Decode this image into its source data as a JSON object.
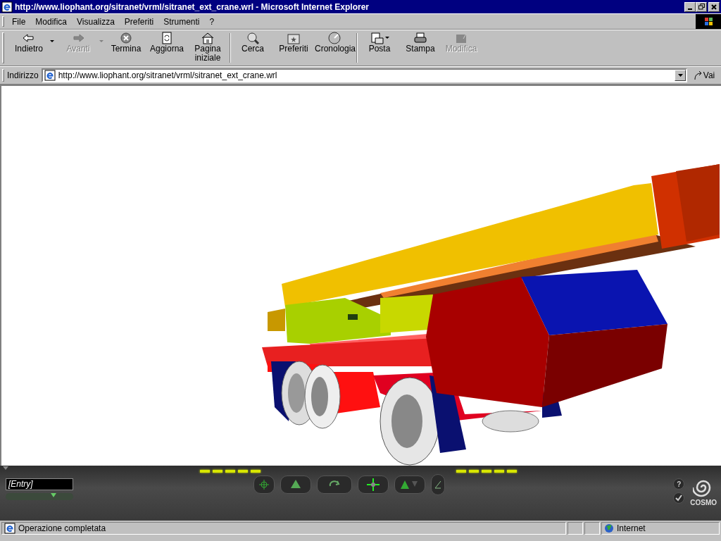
{
  "window": {
    "title": "http://www.liophant.org/sitranet/vrml/sitranet_ext_crane.wrl - Microsoft Internet Explorer"
  },
  "menu": [
    "File",
    "Modifica",
    "Visualizza",
    "Preferiti",
    "Strumenti",
    "?"
  ],
  "toolbar": {
    "groups": [
      [
        {
          "label": "Indietro",
          "disabled": false,
          "dropdown": true
        },
        {
          "label": "Avanti",
          "disabled": true,
          "dropdown": true
        },
        {
          "label": "Termina",
          "disabled": false,
          "dropdown": false
        },
        {
          "label": "Aggiorna",
          "disabled": false,
          "dropdown": false
        },
        {
          "label": "Pagina iniziale",
          "disabled": false,
          "dropdown": false
        }
      ],
      [
        {
          "label": "Cerca",
          "disabled": false,
          "dropdown": false
        },
        {
          "label": "Preferiti",
          "disabled": false,
          "dropdown": false
        },
        {
          "label": "Cronologia",
          "disabled": false,
          "dropdown": false
        }
      ],
      [
        {
          "label": "Posta",
          "disabled": false,
          "dropdown": true
        },
        {
          "label": "Stampa",
          "disabled": false,
          "dropdown": false
        },
        {
          "label": "Modifica",
          "disabled": true,
          "dropdown": false
        }
      ]
    ]
  },
  "address_bar": {
    "label": "Indirizzo",
    "url": "http://www.liophant.org/sitranet/vrml/sitranet_ext_crane.wrl",
    "go": "Vai"
  },
  "viewer": {
    "entry": "[Entry]",
    "help": "?",
    "logo": "COSMO"
  },
  "status_bar": {
    "text": "Operazione completata",
    "zone": "Internet"
  }
}
